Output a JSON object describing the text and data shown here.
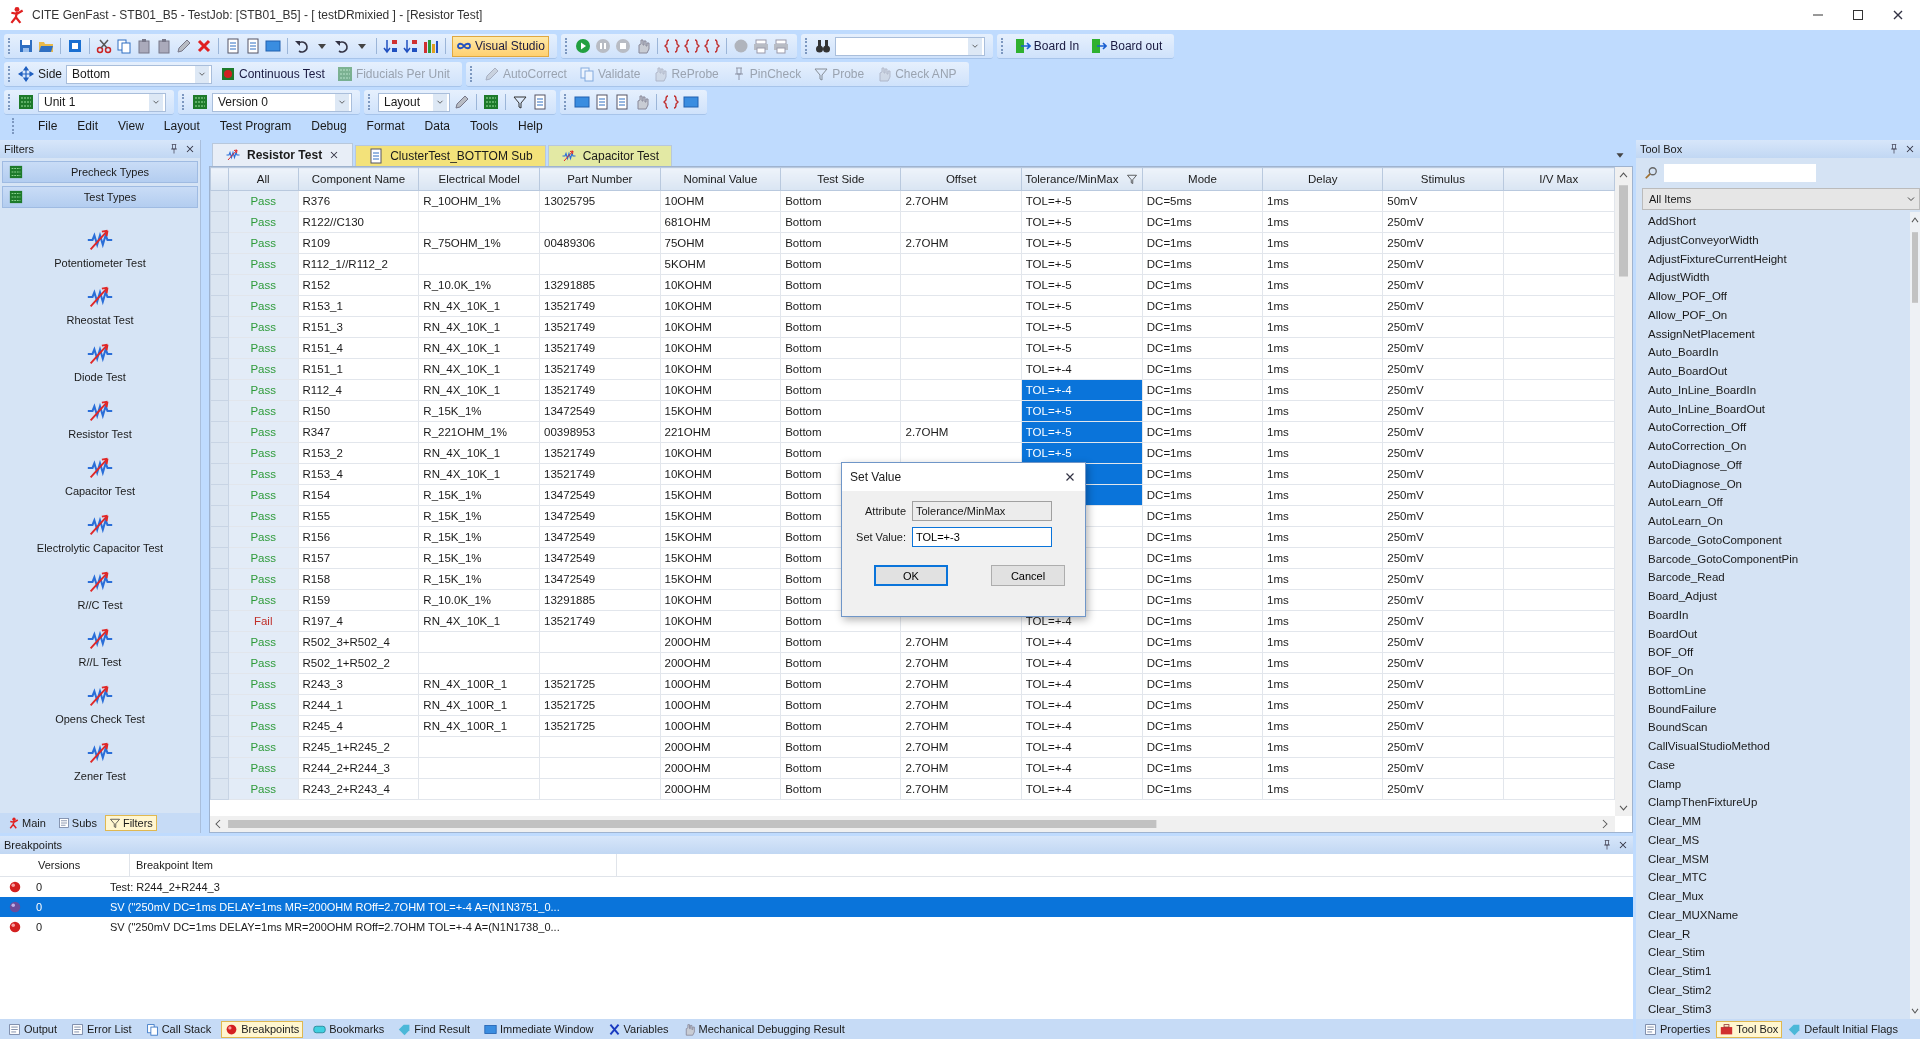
{
  "window": {
    "title": "CITE GenFast - STB01_B5 - TestJob: [STB01_B5] - [ testDRmixied ] - [Resistor Test]"
  },
  "toolbar_1": {
    "visual_studio": {
      "label": "Visual Studio",
      "on": true
    },
    "board_buttons": [
      {
        "label": "Board In"
      },
      {
        "label": "Board out"
      }
    ]
  },
  "toolbar_2": {
    "side_label": "Side",
    "side_value": "Bottom",
    "buttons": [
      {
        "label": "Continuous Test",
        "disabled": false
      },
      {
        "label": "Fiducials Per Unit",
        "disabled": true
      },
      {
        "label": "AutoCorrect",
        "disabled": true
      },
      {
        "label": "Validate",
        "disabled": true
      },
      {
        "label": "ReProbe",
        "disabled": true
      },
      {
        "label": "PinCheck",
        "disabled": true
      },
      {
        "label": "Probe",
        "disabled": true
      },
      {
        "label": "Check ANP",
        "disabled": true
      }
    ]
  },
  "toolbar_3": {
    "unit": "Unit 1",
    "version": "Version 0",
    "view": "Layout"
  },
  "menu": [
    "File",
    "Edit",
    "View",
    "Layout",
    "Test Program",
    "Debug",
    "Format",
    "Data",
    "Tools",
    "Help"
  ],
  "sidebar": {
    "title": "Filters",
    "sections": [
      "Precheck Types",
      "Test Types"
    ],
    "items": [
      "Potentiometer Test",
      "Rheostat Test",
      "Diode Test",
      "Resistor Test",
      "Capacitor Test",
      "Electrolytic Capacitor Test",
      "R//C Test",
      "R//L Test",
      "Opens Check Test",
      "Zener Test"
    ],
    "tabs": [
      {
        "label": "Main",
        "selected": false
      },
      {
        "label": "Subs",
        "selected": false
      },
      {
        "label": "Filters",
        "selected": true
      }
    ]
  },
  "document_tabs": [
    {
      "label": "Resistor Test",
      "selected": true,
      "color": "#e8eef7"
    },
    {
      "label": "ClusterTest_BOTTOM Sub",
      "selected": false,
      "color": "#f3e27a"
    },
    {
      "label": "Capacitor Test",
      "selected": false,
      "color": "#e3e9a4"
    }
  ],
  "table": {
    "columns": [
      "All",
      "Component Name",
      "Electrical Model",
      "Part Number",
      "Nominal Value",
      "Test Side",
      "Offset",
      "Tolerance/MinMax",
      "Mode",
      "Delay",
      "Stimulus",
      "I/V Max"
    ],
    "rows": [
      {
        "result": "Pass",
        "failed": false,
        "tolerance_selected": false,
        "component": "R376",
        "model": "R_10OHM_1%",
        "part": "13025795",
        "nominal": "10OHM",
        "side": "Bottom",
        "offset": "2.7OHM",
        "tolerance": "TOL=+-5",
        "mode": "DC=5ms",
        "delay": "1ms",
        "stimulus": "50mV"
      },
      {
        "result": "Pass",
        "failed": false,
        "tolerance_selected": false,
        "component": "R122//C130",
        "nominal": "681OHM",
        "side": "Bottom",
        "tolerance": "TOL=+-5",
        "mode": "DC=1ms",
        "delay": "1ms",
        "stimulus": "250mV"
      },
      {
        "result": "Pass",
        "failed": false,
        "tolerance_selected": false,
        "component": "R109",
        "model": "R_75OHM_1%",
        "part": "00489306",
        "nominal": "75OHM",
        "side": "Bottom",
        "offset": "2.7OHM",
        "tolerance": "TOL=+-5",
        "mode": "DC=1ms",
        "delay": "1ms",
        "stimulus": "250mV"
      },
      {
        "result": "Pass",
        "failed": false,
        "tolerance_selected": false,
        "component": "R112_1//R112_2",
        "nominal": "5KOHM",
        "side": "Bottom",
        "tolerance": "TOL=+-5",
        "mode": "DC=1ms",
        "delay": "1ms",
        "stimulus": "250mV"
      },
      {
        "result": "Pass",
        "failed": false,
        "tolerance_selected": false,
        "component": "R152",
        "model": "R_10.0K_1%",
        "part": "13291885",
        "nominal": "10KOHM",
        "side": "Bottom",
        "tolerance": "TOL=+-5",
        "mode": "DC=1ms",
        "delay": "1ms",
        "stimulus": "250mV"
      },
      {
        "result": "Pass",
        "failed": false,
        "tolerance_selected": false,
        "component": "R153_1",
        "model": "RN_4X_10K_1",
        "part": "13521749",
        "nominal": "10KOHM",
        "side": "Bottom",
        "tolerance": "TOL=+-5",
        "mode": "DC=1ms",
        "delay": "1ms",
        "stimulus": "250mV"
      },
      {
        "result": "Pass",
        "failed": false,
        "tolerance_selected": false,
        "component": "R151_3",
        "model": "RN_4X_10K_1",
        "part": "13521749",
        "nominal": "10KOHM",
        "side": "Bottom",
        "tolerance": "TOL=+-5",
        "mode": "DC=1ms",
        "delay": "1ms",
        "stimulus": "250mV"
      },
      {
        "result": "Pass",
        "failed": false,
        "tolerance_selected": false,
        "component": "R151_4",
        "model": "RN_4X_10K_1",
        "part": "13521749",
        "nominal": "10KOHM",
        "side": "Bottom",
        "tolerance": "TOL=+-5",
        "mode": "DC=1ms",
        "delay": "1ms",
        "stimulus": "250mV"
      },
      {
        "result": "Pass",
        "failed": false,
        "tolerance_selected": false,
        "component": "R151_1",
        "model": "RN_4X_10K_1",
        "part": "13521749",
        "nominal": "10KOHM",
        "side": "Bottom",
        "tolerance": "TOL=+-4",
        "mode": "DC=1ms",
        "delay": "1ms",
        "stimulus": "250mV"
      },
      {
        "result": "Pass",
        "failed": false,
        "tolerance_selected": true,
        "component": "R112_4",
        "model": "RN_4X_10K_1",
        "part": "13521749",
        "nominal": "10KOHM",
        "side": "Bottom",
        "tolerance": "TOL=+-4",
        "mode": "DC=1ms",
        "delay": "1ms",
        "stimulus": "250mV"
      },
      {
        "result": "Pass",
        "failed": false,
        "tolerance_selected": true,
        "component": "R150",
        "model": "R_15K_1%",
        "part": "13472549",
        "nominal": "15KOHM",
        "side": "Bottom",
        "tolerance": "TOL=+-5",
        "mode": "DC=1ms",
        "delay": "1ms",
        "stimulus": "250mV"
      },
      {
        "result": "Pass",
        "failed": false,
        "tolerance_selected": true,
        "component": "R347",
        "model": "R_221OHM_1%",
        "part": "00398953",
        "nominal": "221OHM",
        "side": "Bottom",
        "offset": "2.7OHM",
        "tolerance": "TOL=+-5",
        "mode": "DC=1ms",
        "delay": "1ms",
        "stimulus": "250mV"
      },
      {
        "result": "Pass",
        "failed": false,
        "tolerance_selected": true,
        "component": "R153_2",
        "model": "RN_4X_10K_1",
        "part": "13521749",
        "nominal": "10KOHM",
        "side": "Bottom",
        "tolerance": "TOL=+-5",
        "mode": "DC=1ms",
        "delay": "1ms",
        "stimulus": "250mV"
      },
      {
        "result": "Pass",
        "failed": false,
        "tolerance_selected": true,
        "component": "R153_4",
        "model": "RN_4X_10K_1",
        "part": "13521749",
        "nominal": "10KOHM",
        "side": "Bottom",
        "mode": "DC=1ms",
        "delay": "1ms",
        "stimulus": "250mV"
      },
      {
        "result": "Pass",
        "failed": false,
        "tolerance_selected": true,
        "component": "R154",
        "model": "R_15K_1%",
        "part": "13472549",
        "nominal": "15KOHM",
        "side": "Bottom",
        "mode": "DC=1ms",
        "delay": "1ms",
        "stimulus": "250mV"
      },
      {
        "result": "Pass",
        "failed": false,
        "tolerance_selected": false,
        "component": "R155",
        "model": "R_15K_1%",
        "part": "13472549",
        "nominal": "15KOHM",
        "side": "Bottom",
        "mode": "DC=1ms",
        "delay": "1ms",
        "stimulus": "250mV"
      },
      {
        "result": "Pass",
        "failed": false,
        "tolerance_selected": false,
        "component": "R156",
        "model": "R_15K_1%",
        "part": "13472549",
        "nominal": "15KOHM",
        "side": "Bottom",
        "mode": "DC=1ms",
        "delay": "1ms",
        "stimulus": "250mV"
      },
      {
        "result": "Pass",
        "failed": false,
        "tolerance_selected": false,
        "component": "R157",
        "model": "R_15K_1%",
        "part": "13472549",
        "nominal": "15KOHM",
        "side": "Bottom",
        "mode": "DC=1ms",
        "delay": "1ms",
        "stimulus": "250mV"
      },
      {
        "result": "Pass",
        "failed": false,
        "tolerance_selected": false,
        "component": "R158",
        "model": "R_15K_1%",
        "part": "13472549",
        "nominal": "15KOHM",
        "side": "Bottom",
        "mode": "DC=1ms",
        "delay": "1ms",
        "stimulus": "250mV"
      },
      {
        "result": "Pass",
        "failed": false,
        "tolerance_selected": false,
        "component": "R159",
        "model": "R_10.0K_1%",
        "part": "13291885",
        "nominal": "10KOHM",
        "side": "Bottom",
        "mode": "DC=1ms",
        "delay": "1ms",
        "stimulus": "250mV"
      },
      {
        "result": "Fail",
        "failed": true,
        "tolerance_selected": false,
        "component": "R197_4",
        "model": "RN_4X_10K_1",
        "part": "13521749",
        "nominal": "10KOHM",
        "side": "Bottom",
        "tolerance": "TOL=+-4",
        "mode": "DC=1ms",
        "delay": "1ms",
        "stimulus": "250mV"
      },
      {
        "result": "Pass",
        "failed": false,
        "tolerance_selected": false,
        "component": "R502_3+R502_4",
        "nominal": "200OHM",
        "side": "Bottom",
        "offset": "2.7OHM",
        "tolerance": "TOL=+-4",
        "mode": "DC=1ms",
        "delay": "1ms",
        "stimulus": "250mV"
      },
      {
        "result": "Pass",
        "failed": false,
        "tolerance_selected": false,
        "component": "R502_1+R502_2",
        "nominal": "200OHM",
        "side": "Bottom",
        "offset": "2.7OHM",
        "tolerance": "TOL=+-4",
        "mode": "DC=1ms",
        "delay": "1ms",
        "stimulus": "250mV"
      },
      {
        "result": "Pass",
        "failed": false,
        "tolerance_selected": false,
        "component": "R243_3",
        "model": "RN_4X_100R_1",
        "part": "13521725",
        "nominal": "100OHM",
        "side": "Bottom",
        "offset": "2.7OHM",
        "tolerance": "TOL=+-4",
        "mode": "DC=1ms",
        "delay": "1ms",
        "stimulus": "250mV"
      },
      {
        "result": "Pass",
        "failed": false,
        "tolerance_selected": false,
        "component": "R244_1",
        "model": "RN_4X_100R_1",
        "part": "13521725",
        "nominal": "100OHM",
        "side": "Bottom",
        "offset": "2.7OHM",
        "tolerance": "TOL=+-4",
        "mode": "DC=1ms",
        "delay": "1ms",
        "stimulus": "250mV"
      },
      {
        "result": "Pass",
        "failed": false,
        "tolerance_selected": false,
        "component": "R245_4",
        "model": "RN_4X_100R_1",
        "part": "13521725",
        "nominal": "100OHM",
        "side": "Bottom",
        "offset": "2.7OHM",
        "tolerance": "TOL=+-4",
        "mode": "DC=1ms",
        "delay": "1ms",
        "stimulus": "250mV"
      },
      {
        "result": "Pass",
        "failed": false,
        "tolerance_selected": false,
        "component": "R245_1+R245_2",
        "nominal": "200OHM",
        "side": "Bottom",
        "offset": "2.7OHM",
        "tolerance": "TOL=+-4",
        "mode": "DC=1ms",
        "delay": "1ms",
        "stimulus": "250mV"
      },
      {
        "result": "Pass",
        "failed": false,
        "tolerance_selected": false,
        "component": "R244_2+R244_3",
        "nominal": "200OHM",
        "side": "Bottom",
        "offset": "2.7OHM",
        "tolerance": "TOL=+-4",
        "mode": "DC=1ms",
        "delay": "1ms",
        "stimulus": "250mV"
      },
      {
        "result": "Pass",
        "failed": false,
        "tolerance_selected": false,
        "component": "R243_2+R243_4",
        "nominal": "200OHM",
        "side": "Bottom",
        "offset": "2.7OHM",
        "tolerance": "TOL=+-4",
        "mode": "DC=1ms",
        "delay": "1ms",
        "stimulus": "250mV"
      }
    ]
  },
  "dialog": {
    "title": "Set Value",
    "attribute_label": "Attribute",
    "attribute_value": "Tolerance/MinMax",
    "value_label": "Set Value:",
    "value": "TOL=+-3",
    "buttons": [
      {
        "label": "OK",
        "default": true
      },
      {
        "label": "Cancel",
        "default": false
      }
    ]
  },
  "breakpoints": {
    "title": "Breakpoints",
    "columns": [
      "Versions",
      "Breakpoint Item"
    ],
    "rows": [
      {
        "version": "0",
        "item": "Test: R244_2+R244_3",
        "selected": false
      },
      {
        "version": "0",
        "item": "SV (\"250mV DC=1ms DELAY=1ms MR=200OHM ROff=2.7OHM TOL=+-4 A=(N1N3751_0...",
        "selected": true
      },
      {
        "version": "0",
        "item": "SV (\"250mV DC=1ms DELAY=1ms MR=200OHM ROff=2.7OHM TOL=+-4 A=(N1N1738_0...",
        "selected": false
      }
    ]
  },
  "output_tabs": [
    {
      "label": "Output",
      "selected": false
    },
    {
      "label": "Error List",
      "selected": false
    },
    {
      "label": "Call Stack",
      "selected": false
    },
    {
      "label": "Breakpoints",
      "selected": true
    },
    {
      "label": "Bookmarks",
      "selected": false
    },
    {
      "label": "Find Result",
      "selected": false
    },
    {
      "label": "Immediate Window",
      "selected": false
    },
    {
      "label": "Variables",
      "selected": false
    },
    {
      "label": "Mechanical Debugging Result",
      "selected": false
    }
  ],
  "toolbox": {
    "title": "Tool Box",
    "filter": "All Items",
    "items": [
      "AddShort",
      "AdjustConveyorWidth",
      "AdjustFixtureCurrentHeight",
      "AdjustWidth",
      "Allow_POF_Off",
      "Allow_POF_On",
      "AssignNetPlacement",
      "Auto_BoardIn",
      "Auto_BoardOut",
      "Auto_InLine_BoardIn",
      "Auto_InLine_BoardOut",
      "AutoCorrection_Off",
      "AutoCorrection_On",
      "AutoDiagnose_Off",
      "AutoDiagnose_On",
      "AutoLearn_Off",
      "AutoLearn_On",
      "Barcode_GotoComponent",
      "Barcode_GotoComponentPin",
      "Barcode_Read",
      "Board_Adjust",
      "BoardIn",
      "BoardOut",
      "BOF_Off",
      "BOF_On",
      "BottomLine",
      "BoundFailure",
      "BoundScan",
      "CallVisualStudioMethod",
      "Case",
      "Clamp",
      "ClampThenFixtureUp",
      "Clear_MM",
      "Clear_MS",
      "Clear_MSM",
      "Clear_MTC",
      "Clear_Mux",
      "Clear_MUXName",
      "Clear_R",
      "Clear_Stim",
      "Clear_Stim1",
      "Clear_Stim2",
      "Clear_Stim3"
    ],
    "tabs": [
      {
        "label": "Properties",
        "selected": false
      },
      {
        "label": "Tool Box",
        "selected": true
      },
      {
        "label": "Default Initial Flags",
        "selected": false
      }
    ]
  }
}
